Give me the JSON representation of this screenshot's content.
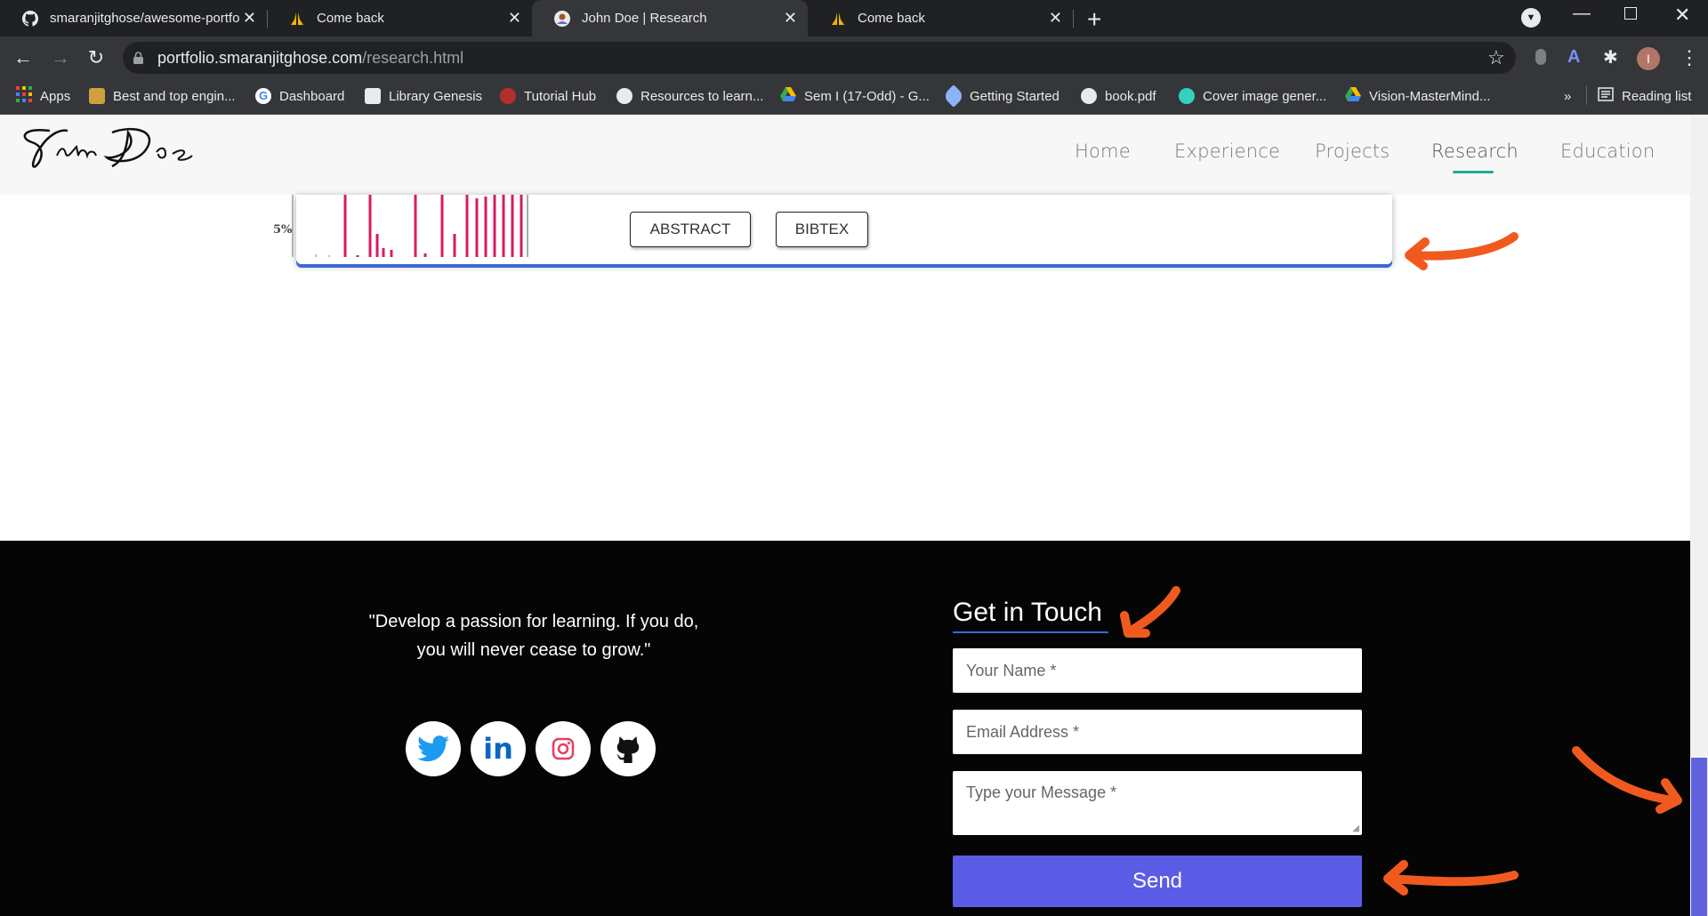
{
  "browser": {
    "tabs": [
      {
        "title": "smaranjitghose/awesome-portfo",
        "icon": "github-icon",
        "active": false
      },
      {
        "title": "Come back",
        "icon": "praying-hands-icon",
        "active": false
      },
      {
        "title": "John Doe | Research",
        "icon": "avatar-icon",
        "active": true
      },
      {
        "title": "Come back",
        "icon": "praying-hands-icon",
        "active": false
      }
    ],
    "url_host": "portfolio.smaranjitghose.com",
    "url_path": "/research.html",
    "bookmarks": [
      {
        "label": "Apps",
        "icon": "apps-grid-icon",
        "color": "#ea4335"
      },
      {
        "label": "Best and top engin...",
        "icon": "site-icon",
        "color": "#d0a040"
      },
      {
        "label": "Dashboard",
        "icon": "google-icon",
        "color": "#4285f4"
      },
      {
        "label": "Library Genesis",
        "icon": "book-icon",
        "color": "#e8eaed"
      },
      {
        "label": "Tutorial Hub",
        "icon": "spider-icon",
        "color": "#b03030"
      },
      {
        "label": "Resources to learn...",
        "icon": "github-icon",
        "color": "#e8eaed"
      },
      {
        "label": "Sem I (17-Odd) - G...",
        "icon": "drive-icon",
        "color": "#fbbc04"
      },
      {
        "label": "Getting Started",
        "icon": "rocket-icon",
        "color": "#8ab4f8"
      },
      {
        "label": "book.pdf",
        "icon": "globe-icon",
        "color": "#e8eaed"
      },
      {
        "label": "Cover image gener...",
        "icon": "circle-icon",
        "color": "#34d0c0"
      },
      {
        "label": "Vision-MasterMind...",
        "icon": "drive-icon",
        "color": "#fbbc04"
      }
    ],
    "overflow_label": "»",
    "reading_list": "Reading list",
    "profile_initial": "I"
  },
  "site": {
    "nav": [
      "Home",
      "Experience",
      "Projects",
      "Research",
      "Education"
    ],
    "active_nav": "Research",
    "chart_tick": "5%",
    "buttons": {
      "abstract": "ABSTRACT",
      "bibtex": "BIBTEX"
    }
  },
  "footer": {
    "quote_line1": "\"Develop a passion for learning. If you do,",
    "quote_line2": "you will never cease to grow.\"",
    "social": [
      "twitter-icon",
      "linkedin-icon",
      "instagram-icon",
      "github-icon"
    ],
    "contact_title": "Get in Touch",
    "name_placeholder": "Your Name *",
    "email_placeholder": "Email Address *",
    "message_placeholder": "Type your Message *",
    "send_label": "Send"
  },
  "colors": {
    "accent_underline": "#1fa99a",
    "send_button": "#5b5ce6",
    "annotation_arrow": "#f15a1f",
    "chart_bars": "#d81b60"
  }
}
